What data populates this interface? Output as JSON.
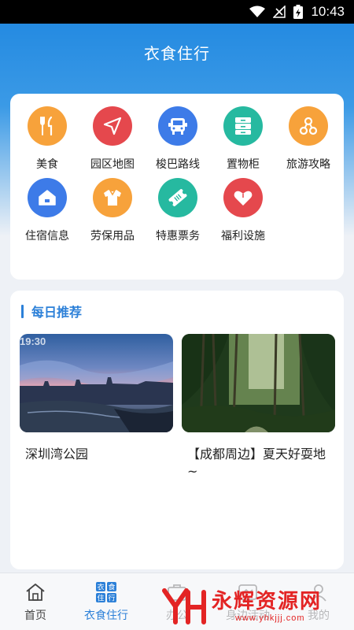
{
  "status_bar": {
    "time": "10:43"
  },
  "header": {
    "title": "衣食住行"
  },
  "services": [
    {
      "label": "美食",
      "icon": "utensils-icon",
      "color": "#f7a23b"
    },
    {
      "label": "园区地图",
      "icon": "navigation-arrow-icon",
      "color": "#e5484d"
    },
    {
      "label": "梭巴路线",
      "icon": "bus-icon",
      "color": "#3d7be8"
    },
    {
      "label": "置物柜",
      "icon": "locker-icon",
      "color": "#26b9a0"
    },
    {
      "label": "旅游攻略",
      "icon": "travel-icon",
      "color": "#f7a23b"
    },
    {
      "label": "住宿信息",
      "icon": "home-icon",
      "color": "#3d7be8"
    },
    {
      "label": "劳保用品",
      "icon": "shirt-icon",
      "color": "#f7a23b"
    },
    {
      "label": "特惠票务",
      "icon": "ticket-icon",
      "color": "#26b9a0"
    },
    {
      "label": "福利设施",
      "icon": "heart-icon",
      "color": "#e5484d"
    }
  ],
  "recommend": {
    "title": "每日推荐",
    "items": [
      {
        "name": "深圳湾公园",
        "stamp": "19:30"
      },
      {
        "name": "【成都周边】夏天好耍地~"
      }
    ]
  },
  "tabbar": [
    {
      "label": "首页",
      "icon": "home-outline-icon"
    },
    {
      "label": "衣食住行",
      "icon": "clothing-food-housing-travel-icon",
      "active": true,
      "glyphs": [
        "衣",
        "食",
        "住",
        "行"
      ]
    },
    {
      "label": "办公",
      "icon": "briefcase-icon"
    },
    {
      "label": "身边活动",
      "icon": "activity-icon"
    },
    {
      "label": "我的",
      "icon": "person-icon"
    }
  ],
  "watermark": {
    "main": "永辉资源网",
    "sub": "www.yhkjjj.com",
    "logo": "YH"
  },
  "colors": {
    "accent": "#2c80d8",
    "header_gradient_top": "#1e86e0",
    "page_bg": "#eef1f6"
  }
}
